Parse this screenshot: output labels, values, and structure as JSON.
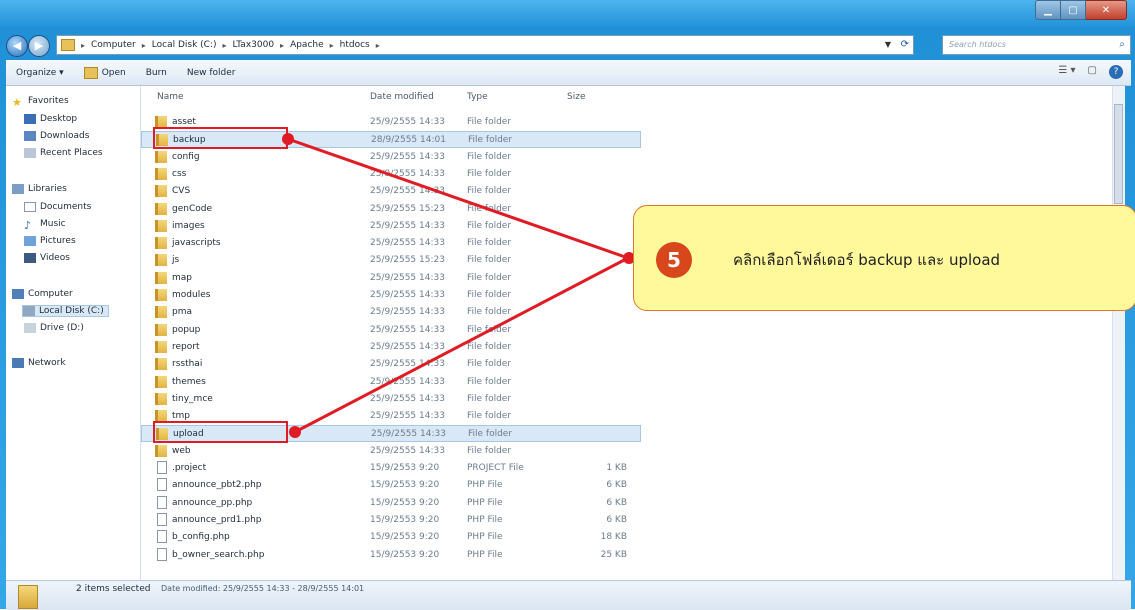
{
  "window": {
    "title_blurred": "",
    "controls": [
      "minimize",
      "maximize",
      "close"
    ]
  },
  "address": {
    "breadcrumbs": [
      "Computer",
      "Local Disk (C:)",
      "LTax3000",
      "Apache",
      "htdocs"
    ],
    "search_placeholder": "Search htdocs"
  },
  "toolbar": {
    "organize": "Organize ▾",
    "open": "Open",
    "burn": "Burn",
    "new_folder": "New folder"
  },
  "nav": {
    "favorites": "Favorites",
    "desktop": "Desktop",
    "downloads": "Downloads",
    "recent": "Recent Places",
    "libraries": "Libraries",
    "documents": "Documents",
    "music": "Music",
    "pictures": "Pictures",
    "videos": "Videos",
    "computer": "Computer",
    "localdisk": "Local Disk (C:)",
    "drive": "Drive (D:)",
    "network": "Network"
  },
  "columns": {
    "name": "Name",
    "date": "Date modified",
    "type": "Type",
    "size": "Size"
  },
  "rows": [
    {
      "name": "asset",
      "date": "25/9/2555 14:33",
      "type": "File folder",
      "size": "",
      "kind": "folder",
      "selected": false
    },
    {
      "name": "backup",
      "date": "28/9/2555 14:01",
      "type": "File folder",
      "size": "",
      "kind": "folder",
      "selected": true
    },
    {
      "name": "config",
      "date": "25/9/2555 14:33",
      "type": "File folder",
      "size": "",
      "kind": "folder",
      "selected": false
    },
    {
      "name": "css",
      "date": "25/9/2555 14:33",
      "type": "File folder",
      "size": "",
      "kind": "folder",
      "selected": false
    },
    {
      "name": "CVS",
      "date": "25/9/2555 14:33",
      "type": "File folder",
      "size": "",
      "kind": "folder",
      "selected": false
    },
    {
      "name": "genCode",
      "date": "25/9/2555 15:23",
      "type": "File folder",
      "size": "",
      "kind": "folder",
      "selected": false
    },
    {
      "name": "images",
      "date": "25/9/2555 14:33",
      "type": "File folder",
      "size": "",
      "kind": "folder",
      "selected": false
    },
    {
      "name": "javascripts",
      "date": "25/9/2555 14:33",
      "type": "File folder",
      "size": "",
      "kind": "folder",
      "selected": false
    },
    {
      "name": "js",
      "date": "25/9/2555 15:23",
      "type": "File folder",
      "size": "",
      "kind": "folder",
      "selected": false
    },
    {
      "name": "map",
      "date": "25/9/2555 14:33",
      "type": "File folder",
      "size": "",
      "kind": "folder",
      "selected": false
    },
    {
      "name": "modules",
      "date": "25/9/2555 14:33",
      "type": "File folder",
      "size": "",
      "kind": "folder",
      "selected": false
    },
    {
      "name": "pma",
      "date": "25/9/2555 14:33",
      "type": "File folder",
      "size": "",
      "kind": "folder",
      "selected": false
    },
    {
      "name": "popup",
      "date": "25/9/2555 14:33",
      "type": "File folder",
      "size": "",
      "kind": "folder",
      "selected": false
    },
    {
      "name": "report",
      "date": "25/9/2555 14:33",
      "type": "File folder",
      "size": "",
      "kind": "folder",
      "selected": false
    },
    {
      "name": "rssthai",
      "date": "25/9/2555 14:33",
      "type": "File folder",
      "size": "",
      "kind": "folder",
      "selected": false
    },
    {
      "name": "themes",
      "date": "25/9/2555 14:33",
      "type": "File folder",
      "size": "",
      "kind": "folder",
      "selected": false
    },
    {
      "name": "tiny_mce",
      "date": "25/9/2555 14:33",
      "type": "File folder",
      "size": "",
      "kind": "folder",
      "selected": false
    },
    {
      "name": "tmp",
      "date": "25/9/2555 14:33",
      "type": "File folder",
      "size": "",
      "kind": "folder",
      "selected": false
    },
    {
      "name": "upload",
      "date": "25/9/2555 14:33",
      "type": "File folder",
      "size": "",
      "kind": "folder",
      "selected": true
    },
    {
      "name": "web",
      "date": "25/9/2555 14:33",
      "type": "File folder",
      "size": "",
      "kind": "folder",
      "selected": false
    },
    {
      "name": ".project",
      "date": "15/9/2553 9:20",
      "type": "PROJECT File",
      "size": "1 KB",
      "kind": "file",
      "selected": false
    },
    {
      "name": "announce_pbt2.php",
      "date": "15/9/2553 9:20",
      "type": "PHP File",
      "size": "6 KB",
      "kind": "file",
      "selected": false
    },
    {
      "name": "announce_pp.php",
      "date": "15/9/2553 9:20",
      "type": "PHP File",
      "size": "6 KB",
      "kind": "file",
      "selected": false
    },
    {
      "name": "announce_prd1.php",
      "date": "15/9/2553 9:20",
      "type": "PHP File",
      "size": "6 KB",
      "kind": "file",
      "selected": false
    },
    {
      "name": "b_config.php",
      "date": "15/9/2553 9:20",
      "type": "PHP File",
      "size": "18 KB",
      "kind": "file",
      "selected": false
    },
    {
      "name": "b_owner_search.php",
      "date": "15/9/2553 9:20",
      "type": "PHP File",
      "size": "25 KB",
      "kind": "file",
      "selected": false
    }
  ],
  "status": {
    "selection": "2 items selected",
    "detail": "Date modified: 25/9/2555 14:33 - 28/9/2555 14:01"
  },
  "callout": {
    "number": "5",
    "text": "คลิกเลือกโฟล์เดอร์ backup และ upload",
    "bg": "#fff99c",
    "border": "#e07828",
    "badge": "#d8471b"
  },
  "colors": {
    "accent_frame": "#1f8fd6",
    "selection": "#d9e8f7",
    "annotation_red": "#e01b24"
  }
}
